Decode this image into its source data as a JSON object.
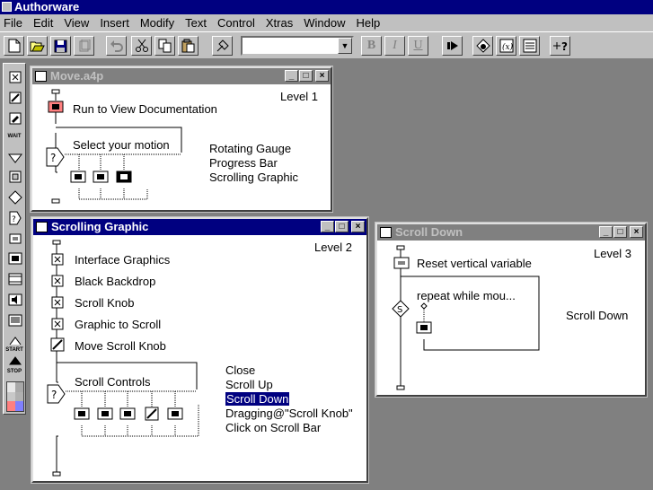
{
  "app": {
    "title": "Authorware"
  },
  "menu": [
    "File",
    "Edit",
    "View",
    "Insert",
    "Modify",
    "Text",
    "Control",
    "Xtras",
    "Window",
    "Help"
  ],
  "toolbar": {
    "new": "new-file-icon",
    "open": "open-folder-icon",
    "save": "save-icon",
    "bold": "B",
    "italic": "I",
    "underline": "U",
    "style_value": ""
  },
  "palette": {
    "wait_label": "WAIT",
    "start_label": "START",
    "stop_label": "STOP",
    "colors": [
      "#e8e8e8",
      "#a8a8a8",
      "#c8c8c8",
      "#b0b0b0",
      "#ff8080",
      "#8080ff"
    ]
  },
  "windows": {
    "move": {
      "title": "Move.a4p",
      "level": "Level 1",
      "icons": [
        "Run to View Documentation",
        "Select your motion"
      ],
      "branches": [
        "Rotating Gauge",
        "Progress Bar",
        "Scrolling Graphic"
      ]
    },
    "scrolling": {
      "title": "Scrolling Graphic",
      "level": "Level 2",
      "icons": [
        "Interface Graphics",
        "Black Backdrop",
        "Scroll Knob",
        "Graphic to Scroll",
        "Move Scroll Knob",
        "Scroll Controls"
      ],
      "branches": [
        "Close",
        "Scroll Up",
        "Scroll Down",
        "Dragging@\"Scroll Knob\"",
        "Click on Scroll Bar"
      ],
      "selected_branch": "Scroll Down"
    },
    "scrolldown": {
      "title": "Scroll Down",
      "level": "Level 3",
      "icons": [
        "Reset vertical variable",
        "repeat while mou..."
      ],
      "branches": [
        "Scroll Down"
      ]
    }
  },
  "colors": {
    "titlebar_active": "#000080",
    "titlebar_inactive": "#808080",
    "face": "#c0c0c0",
    "desktop": "#808080",
    "selected_icon": "#ff8080"
  }
}
